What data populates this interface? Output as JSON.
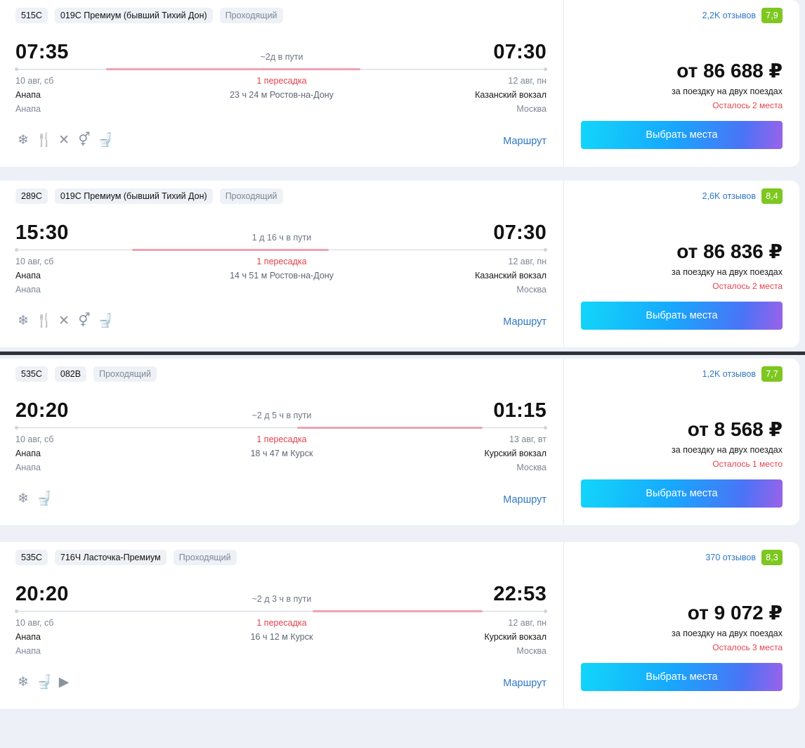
{
  "trips": [
    {
      "train_number": "515С",
      "train_name": "019С Премиум (бывший Тихий Дон)",
      "train_type": "Проходящий",
      "dep_time": "07:35",
      "duration": "~2д в пути",
      "arr_time": "07:30",
      "dep_date": "10 авг, сб",
      "transfers": "1 пересадка",
      "arr_date": "12 авг, пн",
      "dep_station": "Анапа",
      "transfer_info": "23 ч 24 м Ростов-на-Дону",
      "arr_station": "Казанский вокзал",
      "dep_city": "Анапа",
      "arr_city": "Москва",
      "amenities": [
        "snowflake-icon",
        "fork-knife-icon",
        "utensils-crossed-icon",
        "restroom-icon",
        "toilet-icon"
      ],
      "route_label": "Маршрут",
      "reviews": "2,2K отзывов",
      "rating": "7,9",
      "price": "от 86 688 ₽",
      "price_note": "за поездку на двух поездах",
      "seats_left": "Осталось 2 места",
      "button": "Выбрать места",
      "segment": [
        0.17,
        0.65
      ]
    },
    {
      "train_number": "289С",
      "train_name": "019С Премиум (бывший Тихий Дон)",
      "train_type": "Проходящий",
      "dep_time": "15:30",
      "duration": "1 д 16 ч в пути",
      "arr_time": "07:30",
      "dep_date": "10 авг, сб",
      "transfers": "1 пересадка",
      "arr_date": "12 авг, пн",
      "dep_station": "Анапа",
      "transfer_info": "14 ч 51 м Ростов-на-Дону",
      "arr_station": "Казанский вокзал",
      "dep_city": "Анапа",
      "arr_city": "Москва",
      "amenities": [
        "snowflake-icon",
        "fork-knife-icon",
        "utensils-crossed-icon",
        "restroom-icon",
        "toilet-icon"
      ],
      "route_label": "Маршрут",
      "reviews": "2,6K отзывов",
      "rating": "8,4",
      "price": "от 86 836 ₽",
      "price_note": "за поездку на двух поездах",
      "seats_left": "Осталось 2 места",
      "button": "Выбрать места",
      "segment": [
        0.22,
        0.59
      ]
    },
    {
      "train_number": "535С",
      "train_name": "082В",
      "train_type": "Проходящий",
      "dep_time": "20:20",
      "duration": "~2 д 5 ч в пути",
      "arr_time": "01:15",
      "dep_date": "10 авг, сб",
      "transfers": "1 пересадка",
      "arr_date": "13 авг, вт",
      "dep_station": "Анапа",
      "transfer_info": "18 ч 47 м Курск",
      "arr_station": "Курский вокзал",
      "dep_city": "Анапа",
      "arr_city": "Москва",
      "amenities": [
        "snowflake-icon",
        "toilet-icon"
      ],
      "route_label": "Маршрут",
      "reviews": "1,2K отзывов",
      "rating": "7,7",
      "price": "от 8 568 ₽",
      "price_note": "за поездку на двух поездах",
      "seats_left": "Осталось 1 место",
      "button": "Выбрать места",
      "segment": [
        0.53,
        0.88
      ]
    },
    {
      "train_number": "535С",
      "train_name": "716Ч Ласточка-Премиум",
      "train_type": "Проходящий",
      "dep_time": "20:20",
      "duration": "~2 д 3 ч в пути",
      "arr_time": "22:53",
      "dep_date": "10 авг, сб",
      "transfers": "1 пересадка",
      "arr_date": "12 авг, пн",
      "dep_station": "Анапа",
      "transfer_info": "16 ч 12 м Курск",
      "arr_station": "Курский вокзал",
      "dep_city": "Анапа",
      "arr_city": "Москва",
      "amenities": [
        "snowflake-icon",
        "toilet-icon",
        "video-icon"
      ],
      "route_label": "Маршрут",
      "reviews": "370 отзывов",
      "rating": "8,3",
      "price": "от 9 072 ₽",
      "price_note": "за поездку на двух поездах",
      "seats_left": "Осталось 3 места",
      "button": "Выбрать места",
      "segment": [
        0.56,
        0.88
      ]
    }
  ]
}
